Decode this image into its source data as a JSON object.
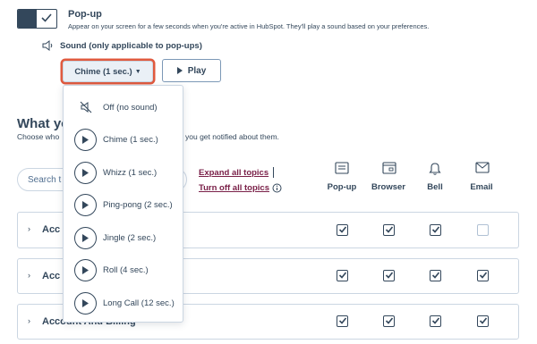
{
  "popup": {
    "title": "Pop-up",
    "description": "Appear on your screen for a few seconds when you're active in HubSpot. They'll play a sound based on your preferences.",
    "toggle_on": true
  },
  "sound": {
    "label": "Sound (only applicable to pop-ups)",
    "selected": "Chime (1 sec.)",
    "play_label": "Play",
    "options": [
      {
        "label": "Off (no sound)",
        "icon": "mute-icon"
      },
      {
        "label": "Chime (1 sec.)",
        "icon": "play-icon"
      },
      {
        "label": "Whizz (1 sec.)",
        "icon": "play-icon"
      },
      {
        "label": "Ping-pong (2 sec.)",
        "icon": "play-icon"
      },
      {
        "label": "Jingle (2 sec.)",
        "icon": "play-icon"
      },
      {
        "label": "Roll (4 sec.)",
        "icon": "play-icon"
      },
      {
        "label": "Long Call (12 sec.)",
        "icon": "play-icon"
      }
    ]
  },
  "section": {
    "title_visible": "What yo",
    "desc_visible_start": "Choose who",
    "desc_visible_end": "you get notified about them."
  },
  "search": {
    "placeholder_visible": "Search t"
  },
  "links": {
    "expand_all": "Expand all topics",
    "turn_off_all": "Turn off all topics"
  },
  "columns": [
    {
      "label": "Pop-up",
      "icon": "popup-icon"
    },
    {
      "label": "Browser",
      "icon": "browser-icon"
    },
    {
      "label": "Bell",
      "icon": "bell-icon"
    },
    {
      "label": "Email",
      "icon": "email-icon"
    }
  ],
  "topics": [
    {
      "label_visible": "Acc",
      "checks": [
        true,
        true,
        true,
        false
      ]
    },
    {
      "label_visible": "Acc",
      "checks": [
        true,
        true,
        true,
        true
      ]
    },
    {
      "label_visible": "Account And Billing",
      "checks": [
        true,
        true,
        true,
        true
      ]
    }
  ],
  "colors": {
    "accent_link": "#7a2048",
    "text": "#33475b",
    "focus_ring": "#e05a3f",
    "border": "#cbd6e2"
  }
}
